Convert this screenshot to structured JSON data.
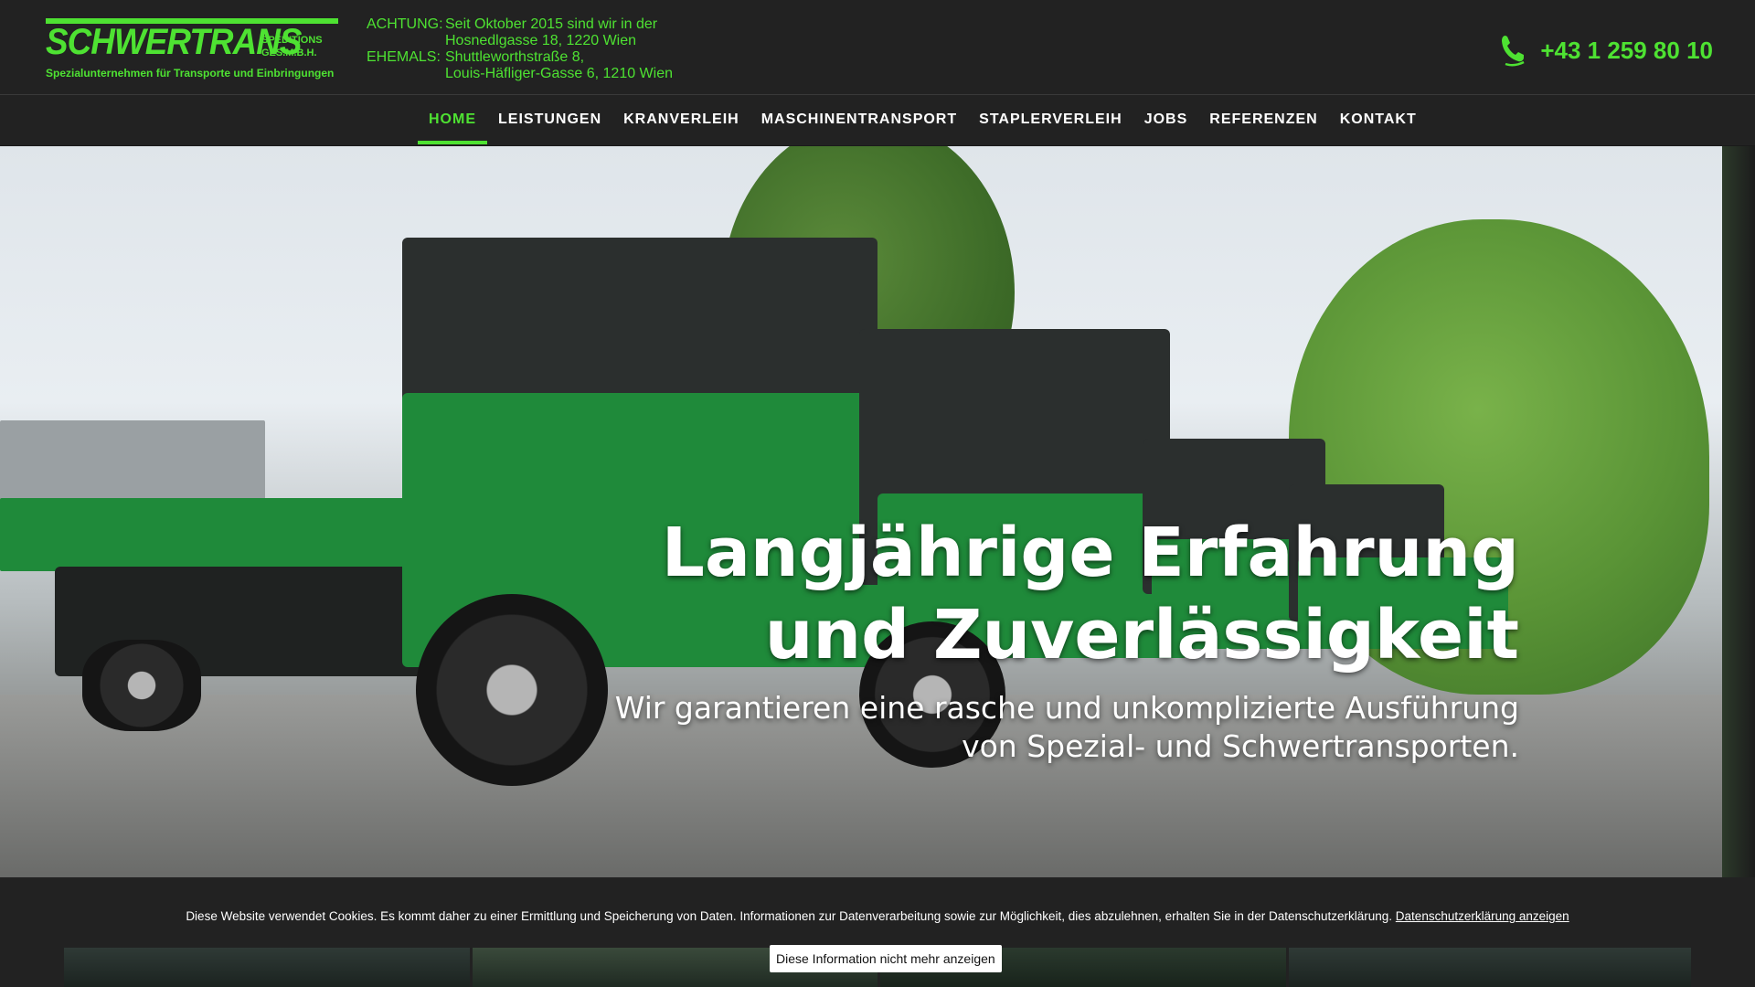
{
  "brand": {
    "name": "SCHWERTRANS",
    "sub": "SPEDITIONS GES.M.B.H.",
    "tagline": "Spezialunternehmen für Transporte und Einbringungen",
    "color": "#4ee232"
  },
  "notice": {
    "label_achtung": "ACHTUNG:",
    "achtung_line1": "Seit Oktober 2015 sind wir in der",
    "achtung_line2": "Hosnedlgasse 18, 1220 Wien",
    "label_ehemals": "EHEMALS:",
    "ehemals_line1": "Shuttleworthstraße 8,",
    "ehemals_line2": "Louis-Häfliger-Gasse 6, 1210 Wien"
  },
  "phone": {
    "icon": "phone-icon",
    "number": "+43 1 259 80 10"
  },
  "nav": {
    "items": [
      {
        "label": "HOME",
        "active": true
      },
      {
        "label": "LEISTUNGEN"
      },
      {
        "label": "KRANVERLEIH"
      },
      {
        "label": "MASCHINENTRANSPORT"
      },
      {
        "label": "STAPLERVERLEIH"
      },
      {
        "label": "JOBS"
      },
      {
        "label": "REFERENZEN"
      },
      {
        "label": "KONTAKT"
      }
    ]
  },
  "hero": {
    "title_line1": "Langjährige Erfahrung",
    "title_line2": "und Zuverlässigkeit",
    "sub_line1": "Wir garantieren eine rasche und unkomplizierte Ausführung",
    "sub_line2": "von Spezial- und Schwertransporten."
  },
  "cookie": {
    "text": "Diese Website verwendet Cookies. Es kommt daher zu einer Ermittlung und Speicherung von Daten. Informationen zur Datenverarbeitung sowie zur Möglichkeit, dies abzulehnen, erhalten Sie in der Datenschutzerklärung.",
    "link": "Datenschutzerklärung anzeigen",
    "button": "Diese Information nicht mehr anzeigen"
  }
}
